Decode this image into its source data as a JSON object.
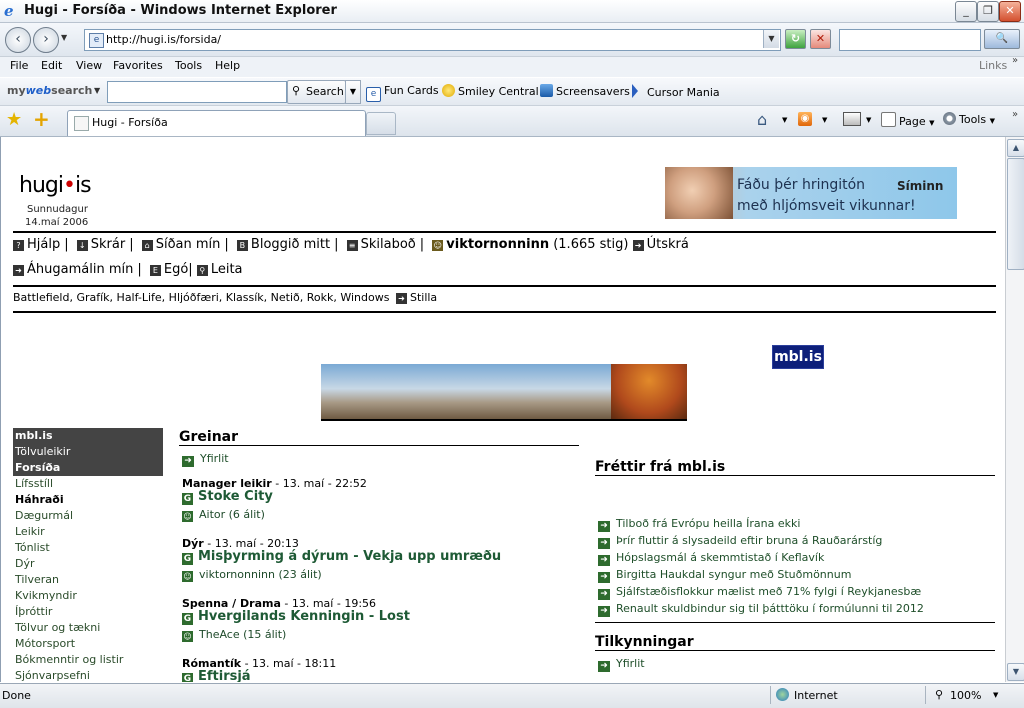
{
  "window": {
    "title": "Hugi - Forsíða - Windows Internet Explorer",
    "controls": [
      "_",
      "❐",
      "✕"
    ]
  },
  "address": {
    "url": "http://hugi.is/forsida/",
    "refresh": "↻",
    "stop": "✕"
  },
  "search": {
    "go": "🔍"
  },
  "menu": [
    "File",
    "Edit",
    "View",
    "Favorites",
    "Tools",
    "Help"
  ],
  "links_label": "Links",
  "toolbar": {
    "mywebsearch_prefix": "my",
    "mywebsearch_brand": "web",
    "mywebsearch_suffix": "search",
    "search_label": "Search",
    "items": [
      "Fun Cards",
      "Smiley Central",
      "Screensavers",
      "Cursor Mania"
    ]
  },
  "tabs": {
    "active": "Hugi - Forsíða"
  },
  "cmdbar": {
    "page": "Page",
    "tools": "Tools"
  },
  "site": {
    "logo_a": "hugi",
    "logo_dot": "•",
    "logo_b": "is",
    "date_day": "Sunnudagur",
    "date": "14.maí 2006",
    "banner_line1": "Fáðu þér hringitón",
    "banner_line2": "með hljómsveit vikunnar!",
    "banner_brand": "Síminn",
    "nav1": [
      {
        "icon": "?",
        "label": "Hjálp"
      },
      {
        "icon": "↓",
        "label": "Skrár"
      },
      {
        "icon": "⌂",
        "label": "Síðan mín"
      },
      {
        "icon": "B",
        "label": "Bloggið mitt"
      },
      {
        "icon": "≡",
        "label": "Skilaboð"
      }
    ],
    "user": {
      "name": "viktornonninn",
      "points": "(1.665 stig)",
      "logout": "Útskrá"
    },
    "nav2": [
      {
        "icon": "➜",
        "label": "Áhugamálin mín"
      },
      {
        "icon": "E",
        "label": "Egó"
      },
      {
        "icon": "⚲",
        "label": "Leita"
      }
    ],
    "hobbies": "Battlefield, Grafík, Half-Life, Hljóðfæri, Klassík, Netið, Rokk, Windows",
    "hobbies_settings": "Stilla",
    "left_heads": [
      "mbl.is",
      "Tölvuleikir",
      "Forsíða"
    ],
    "left_items": [
      "Lífsstíll",
      "Háhraði",
      "Dægurmál",
      "Leikir",
      "Tónlist",
      "Dýr",
      "Tilveran",
      "Kvikmyndir",
      "Íþróttir",
      "Tölvur og tækni",
      "Mótorsport",
      "Bókmenntir og listir",
      "Sjónvarpsefni"
    ],
    "greinar_title": "Greinar",
    "greinar_overview": "Yfirlit",
    "articles": [
      {
        "cat": "Manager leikir",
        "date": " - 13. maí - 22:52",
        "title": "Stoke City",
        "user": "Aitor (6 álit)"
      },
      {
        "cat": "Dýr",
        "date": " - 13. maí - 20:13",
        "title": "Misþyrming á dýrum - Vekja upp umræðu",
        "user": "viktornonninn (23 álit)"
      },
      {
        "cat": "Spenna / Drama",
        "date": " - 13. maí - 19:56",
        "title": "Hvergilands Kenningin - Lost",
        "user": "TheAce (15 álit)"
      },
      {
        "cat": "Rómantík",
        "date": " - 13. maí - 18:11",
        "title": "Eftirsjá"
      }
    ],
    "news_title": "Fréttir frá mbl.is",
    "mbl_badge": "mbl.is",
    "news": [
      "Tilboð frá Evrópu heilla Írana ekki",
      "Þrír fluttir á slysadeild eftir bruna á Rauðarárstíg",
      "Hópslagsmál á skemmtistað í Keflavík",
      "Birgitta Haukdal syngur með Stuðmönnum",
      "Sjálfstæðisflokkur mælist með 71% fylgi í Reykjanesbæ",
      "Renault skuldbindur sig til þátttöku í formúlunni til 2012"
    ],
    "announce_title": "Tilkynningar",
    "announce_overview": "Yfirlit"
  },
  "status": {
    "left": "Done",
    "zone": "Internet",
    "zoom": "100%"
  }
}
